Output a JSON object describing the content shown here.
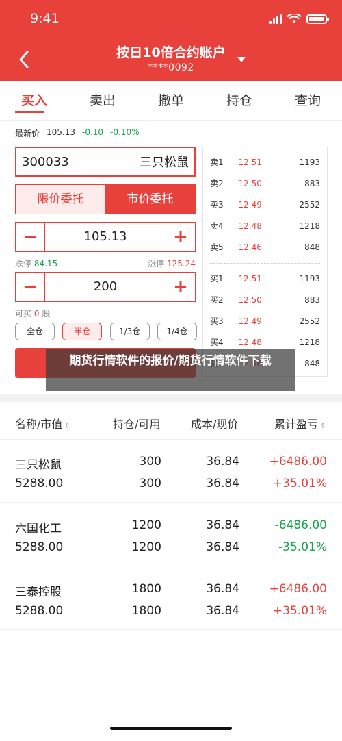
{
  "status": {
    "time": "9:41"
  },
  "header": {
    "title": "按日10倍合约账户",
    "account": "****0092"
  },
  "tabs": [
    "买入",
    "卖出",
    "撤单",
    "持仓",
    "查询"
  ],
  "quote": {
    "label": "最新价",
    "price": "105.13",
    "change": "-0.10",
    "change_pct": "-0.10%"
  },
  "order": {
    "code": "300033",
    "name": "三只松鼠",
    "type_limit": "限价委托",
    "type_market": "市价委托",
    "price": "105.13",
    "limit_down_label": "跌停",
    "limit_down": "84.15",
    "limit_up_label": "涨停",
    "limit_up": "125.24",
    "quantity": "200",
    "can_buy_label": "可买",
    "can_buy_value": "0",
    "can_buy_unit": "股",
    "position_buttons": [
      "全仓",
      "半仓",
      "1/3仓",
      "1/4仓"
    ],
    "minus": "−",
    "plus": "+"
  },
  "order_book": {
    "asks": [
      {
        "label": "卖1",
        "price": "12.51",
        "vol": "1193"
      },
      {
        "label": "卖2",
        "price": "12.50",
        "vol": "883"
      },
      {
        "label": "卖3",
        "price": "12.49",
        "vol": "2552"
      },
      {
        "label": "卖4",
        "price": "12.48",
        "vol": "1218"
      },
      {
        "label": "卖5",
        "price": "12.46",
        "vol": "848"
      }
    ],
    "bids": [
      {
        "label": "买1",
        "price": "12.51",
        "vol": "1193"
      },
      {
        "label": "买2",
        "price": "12.50",
        "vol": "883"
      },
      {
        "label": "买3",
        "price": "12.49",
        "vol": "2552"
      },
      {
        "label": "买4",
        "price": "12.48",
        "vol": "1218"
      },
      {
        "label": "买5",
        "price": "12.46",
        "vol": "848"
      }
    ]
  },
  "overlay_caption": "期货行情软件的报价/期货行情软件下载",
  "positions": {
    "headers": {
      "name": "名称/市值",
      "hold": "持仓/可用",
      "cost": "成本/现价",
      "pnl": "累计盈亏"
    },
    "rows": [
      {
        "name": "三只松鼠",
        "value": "5288.00",
        "hold": "300",
        "avail": "300",
        "cost": "36.84",
        "now": "36.84",
        "pnl": "+6486.00",
        "pnl_pct": "+35.01%",
        "dir": "up"
      },
      {
        "name": "六国化工",
        "value": "5288.00",
        "hold": "1200",
        "avail": "1200",
        "cost": "36.84",
        "now": "36.84",
        "pnl": "-6486.00",
        "pnl_pct": "-35.01%",
        "dir": "down"
      },
      {
        "name": "三泰控股",
        "value": "5288.00",
        "hold": "1800",
        "avail": "1800",
        "cost": "36.84",
        "now": "36.84",
        "pnl": "+6486.00",
        "pnl_pct": "+35.01%",
        "dir": "up"
      }
    ]
  },
  "colors": {
    "brand": "#e8403a",
    "up": "#e8403a",
    "down": "#16a34a"
  }
}
